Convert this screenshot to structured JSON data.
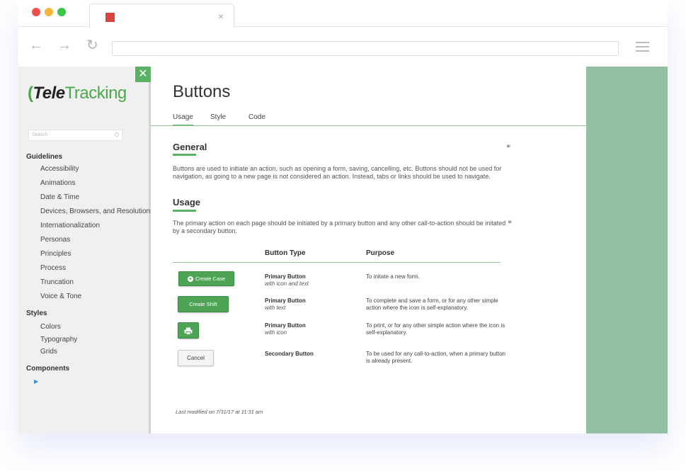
{
  "browser": {
    "tab_close": "×",
    "back": "←",
    "forward": "→",
    "reload": "↻"
  },
  "sidebar": {
    "close": "✕",
    "logo_tele": "Tele",
    "logo_tracking": "Tracking",
    "search_placeholder": "Search",
    "sections": [
      {
        "label": "Guidelines",
        "items": [
          "Accessibility",
          "Animations",
          "Date & Time",
          "Devices, Browsers, and Resolutions",
          "Internationalization",
          "Personas",
          "Principles",
          "Process",
          "Truncation",
          "Voice & Tone"
        ]
      },
      {
        "label": "Styles",
        "items": [
          "Colors",
          "Typography",
          "Grids"
        ]
      },
      {
        "label": "Components",
        "items": []
      }
    ],
    "caret": "▶"
  },
  "content": {
    "title": "Buttons",
    "tabs": [
      "Usage",
      "Style",
      "Code"
    ],
    "general_heading": "General",
    "general_text": "Buttons are used to initiate an action, such as opening a form, saving, cancelling, etc. Buttons should not be used for navigation, as going to a new page is not considered an action. Instead, tabs or links should be used to navigate.",
    "usage_heading": "Usage",
    "usage_text": "The primary action on each page should be initiated by a primary button and any other call-to-action should be initated by a secondary button.",
    "link_icon": "⚭",
    "table": {
      "headers": [
        "Button Type",
        "Purpose"
      ],
      "rows": [
        {
          "button_label": "Create Case",
          "type": "Primary Button",
          "subtype": "with icon and text",
          "purpose": "To initate a new form."
        },
        {
          "button_label": "Create Shift",
          "type": "Primary Button",
          "subtype": "with text",
          "purpose": "To complete and save a form, or for any other simple action where the icon is self-explanatory."
        },
        {
          "button_label": "",
          "type": "Primary Button",
          "subtype": "with icon",
          "purpose": "To print, or for any other simple action where the icon is self-explanatory."
        },
        {
          "button_label": "Cancel",
          "type": "Secondary Button",
          "subtype": "",
          "purpose": "To be used for any call-to-action, when a primary button is already present."
        }
      ]
    },
    "last_modified": "Last modified on 7/31/17 at 11:31 am"
  }
}
